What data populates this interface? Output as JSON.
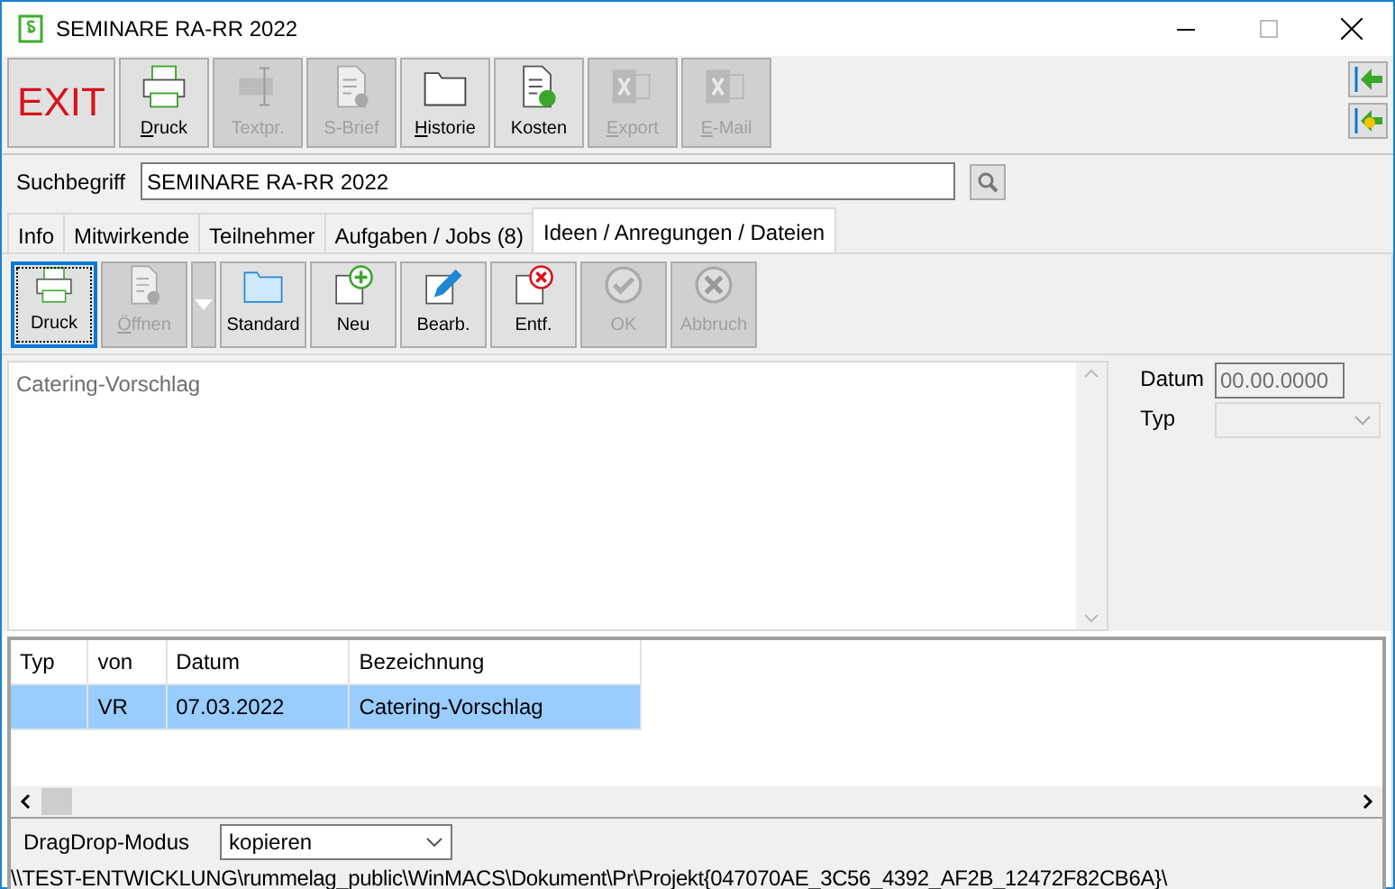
{
  "window": {
    "title": "SEMINARE RA-RR 2022"
  },
  "toolbar": {
    "buttons": [
      {
        "kind": "exit",
        "label": "EXIT",
        "disabled": false,
        "underline_first": false
      },
      {
        "kind": "print",
        "label": "Druck",
        "disabled": false,
        "underline_first": true
      },
      {
        "kind": "text",
        "label": "Textpr.",
        "disabled": true,
        "underline_first": false
      },
      {
        "kind": "letter",
        "label": "S-Brief",
        "disabled": true,
        "underline_first": false
      },
      {
        "kind": "folder",
        "label": "Historie",
        "disabled": false,
        "underline_first": true
      },
      {
        "kind": "costs",
        "label": "Kosten",
        "disabled": false,
        "underline_first": false
      },
      {
        "kind": "excel",
        "label": "Export",
        "disabled": true,
        "underline_first": true
      },
      {
        "kind": "excel",
        "label": "E-Mail",
        "disabled": true,
        "underline_first": true
      }
    ]
  },
  "search": {
    "label": "Suchbegriff",
    "value": "SEMINARE RA-RR 2022"
  },
  "tabs": [
    {
      "label": "Info",
      "selected": false
    },
    {
      "label": "Mitwirkende",
      "selected": false
    },
    {
      "label": "Teilnehmer",
      "selected": false
    },
    {
      "label": "Aufgaben / Jobs (8)",
      "selected": false
    },
    {
      "label": "Ideen / Anregungen / Dateien",
      "selected": true
    }
  ],
  "sub_toolbar": {
    "buttons": [
      {
        "kind": "print",
        "label": "Druck",
        "disabled": false,
        "focused": true,
        "underline_first": false
      },
      {
        "kind": "open",
        "label": "Öffnen",
        "disabled": true,
        "focused": false,
        "underline_first": true
      },
      {
        "kind": "dropdown",
        "disabled": true,
        "focused": false
      },
      {
        "kind": "folder",
        "label": "Standard",
        "disabled": false,
        "focused": false,
        "underline_first": false
      },
      {
        "kind": "new",
        "label": "Neu",
        "disabled": false,
        "focused": false,
        "underline_first": false
      },
      {
        "kind": "edit",
        "label": "Bearb.",
        "disabled": false,
        "focused": false,
        "underline_first": false
      },
      {
        "kind": "delete",
        "label": "Entf.",
        "disabled": false,
        "focused": false,
        "underline_first": false
      },
      {
        "kind": "ok",
        "label": "OK",
        "disabled": true,
        "focused": false,
        "underline_first": false
      },
      {
        "kind": "cancel",
        "label": "Abbruch",
        "disabled": true,
        "focused": false,
        "underline_first": false
      }
    ]
  },
  "note": {
    "value": "Catering-Vorschlag",
    "disabled": true
  },
  "details": {
    "datum_label": "Datum",
    "datum_value": "00.00.0000",
    "typ_label": "Typ",
    "disabled": true
  },
  "table": {
    "columns": [
      "Typ",
      "von",
      "Datum",
      "Bezeichnung"
    ],
    "rows": [
      {
        "cells": [
          "",
          "VR",
          "07.03.2022",
          "Catering-Vorschlag"
        ],
        "selected": true
      }
    ]
  },
  "dragdrop": {
    "label": "DragDrop-Modus",
    "value": "kopieren"
  },
  "status_path": "\\\\TEST-ENTWICKLUNG\\rummelag_public\\WinMACS\\Dokument\\Pr\\Projekt{047070AE_3C56_4392_AF2B_12472F82CB6A}\\"
}
